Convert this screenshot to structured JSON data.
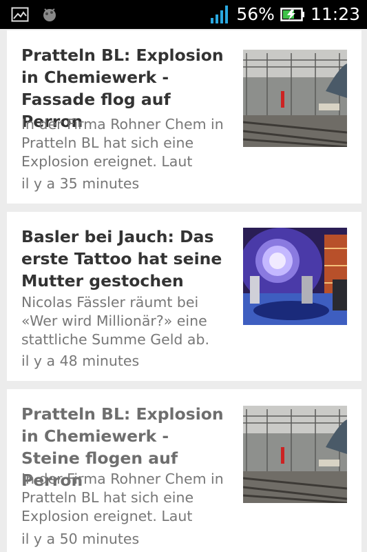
{
  "status_bar": {
    "battery_percent_label": "56%",
    "clock": "11:23",
    "signal_icon": "signal-bars-icon",
    "battery_icon": "battery-charging-icon",
    "notification_icons": [
      "image-icon",
      "app-notification-icon"
    ],
    "colors": {
      "background": "#000000",
      "signal": "#2aa8e0",
      "battery_charge": "#3fc24a"
    }
  },
  "articles": [
    {
      "title": "Pratteln BL: Explosion in Chemiewerk - Fassade flog auf Perron",
      "summary": "In der Firma Rohner Chem in Pratteln BL hat sich eine Explosion ereignet. Laut",
      "time": "il y a 35 minutes",
      "read": false,
      "thumbnail": "railway-station-photo"
    },
    {
      "title": "Basler bei Jauch: Das erste Tattoo hat seine Mutter gestochen",
      "summary": "Nicolas Fässler räumt bei «Wer wird Millionär?» eine stattliche Summe Geld ab.",
      "time": "il y a 48 minutes",
      "read": false,
      "thumbnail": "tv-show-studio-photo"
    },
    {
      "title": "Pratteln BL: Explosion in Chemiewerk - Steine flogen auf Perron",
      "summary": "In der Firma Rohner Chem in Pratteln BL hat sich eine Explosion ereignet. Laut",
      "time": "il y a 50 minutes",
      "read": true,
      "thumbnail": "railway-station-photo"
    }
  ]
}
